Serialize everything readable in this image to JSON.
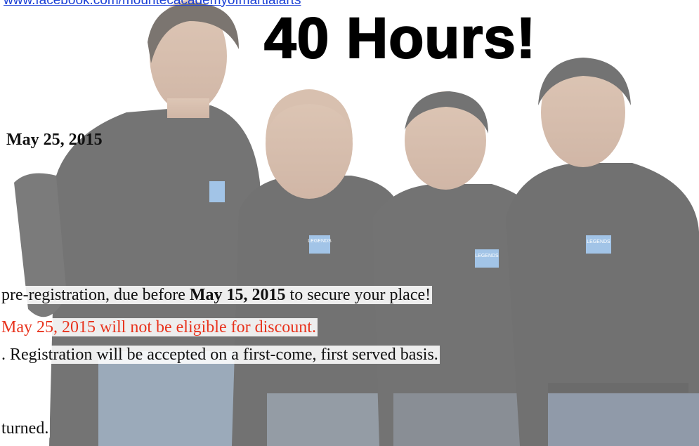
{
  "header": {
    "link_text": "www.facebook.com/mountecacademyofmartialarts",
    "headline": "40 Hours!"
  },
  "event": {
    "date": "May 25, 2015"
  },
  "notes": {
    "line1_prefix": "pre-registration, due before ",
    "line1_bold": "May 15, 2015",
    "line1_suffix": " to secure your place!",
    "line2": "May 25, 2015  will not be eligible for discount.",
    "line3": ". Registration will be accepted on a first-come, first served basis.",
    "line4": "turned."
  },
  "colors": {
    "link": "#1a3fd6",
    "warning": "#e8321c",
    "shirt": "#1b1b1b"
  },
  "photo": {
    "shirt_logo_text": "LEGENDS"
  }
}
